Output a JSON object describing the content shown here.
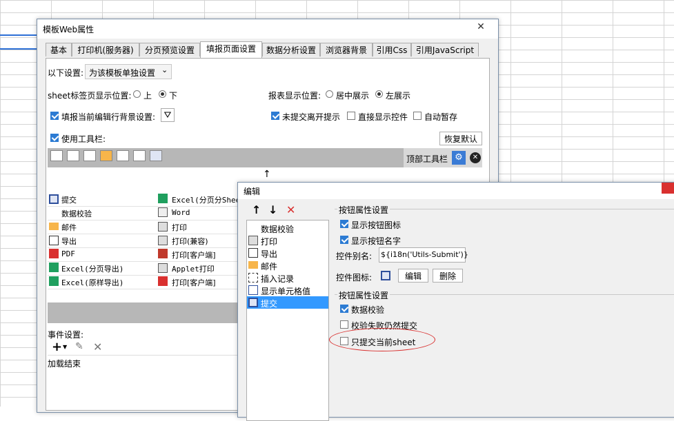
{
  "main_window": {
    "title": "模板Web属性",
    "close_label": "✕",
    "tabs": [
      "基本",
      "打印机(服务器)",
      "分页预览设置",
      "填报页面设置",
      "数据分析设置",
      "浏览器背景",
      "引用Css",
      "引用JavaScript"
    ],
    "active_tab": "填报页面设置",
    "settings_label": "以下设置:",
    "settings_select": "为该模板单独设置",
    "sheet_label": "sheet标签页显示位置:",
    "sheet_opt_top": "上",
    "sheet_opt_bottom": "下",
    "report_pos_label": "报表显示位置:",
    "report_opt_center": "居中展示",
    "report_opt_left": "左展示",
    "fill_bg_label": "填报当前编辑行背景设置:",
    "unsubmit_label": "未提交离开提示",
    "direct_show_label": "直接显示控件",
    "autosave_label": "自动暂存",
    "use_toolbar_label": "使用工具栏:",
    "restore_default": "恢复默认",
    "top_toolbar_label": "顶部工具栏",
    "event_label": "事件设置:",
    "event_item": "加载结束"
  },
  "button_list": {
    "left_col": [
      "提交",
      "数据校验",
      "邮件",
      "导出",
      "PDF",
      "Excel(分页导出)",
      "Excel(原样导出)"
    ],
    "right_col": [
      "Excel(分页分Shee",
      "Word",
      "打印",
      "打印(兼容)",
      "打印[客户端]",
      "Applet打印",
      "打印[客户端]"
    ]
  },
  "edit_dialog": {
    "title": "编辑",
    "list_items": [
      "数据校验",
      "打印",
      "导出",
      "邮件",
      "插入记录",
      "显示单元格值",
      "提交"
    ],
    "selected_item": "提交",
    "group1_title": "按钮属性设置",
    "show_icon_label": "显示按钮图标",
    "show_name_label": "显示按钮名字",
    "alias_label": "控件别名:",
    "alias_value": "${i18n('Utils-Submit')}",
    "icon_label": "控件图标:",
    "edit_button": "编辑",
    "delete_button": "删除",
    "group2_title": "按钮属性设置",
    "data_check_label": "数据校验",
    "submit_on_fail_label": "校验失败仍然提交",
    "submit_current_sheet_label": "只提交当前sheet"
  },
  "colors": {
    "accent": "#2c7bd3",
    "highlight_oval": "#d9302f",
    "selected": "#3399ff"
  }
}
